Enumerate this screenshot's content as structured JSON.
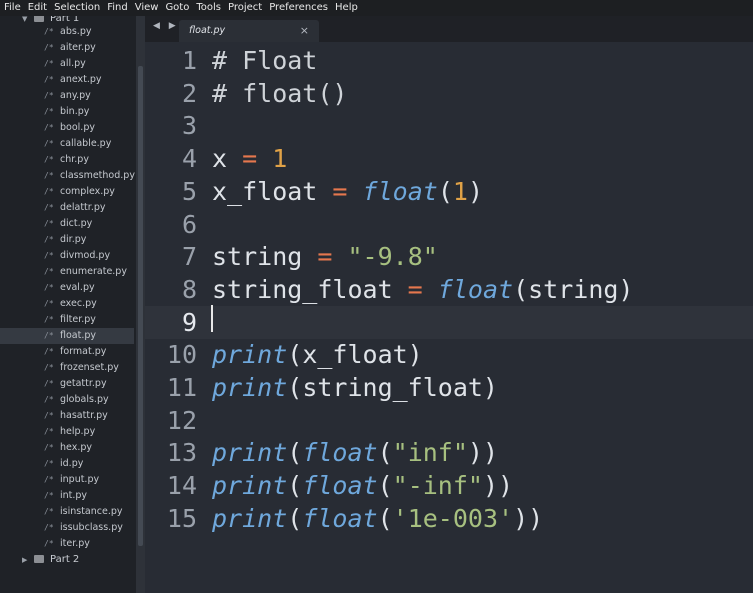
{
  "menu": [
    "File",
    "Edit",
    "Selection",
    "Find",
    "View",
    "Goto",
    "Tools",
    "Project",
    "Preferences",
    "Help"
  ],
  "sidebar": {
    "folder_top": "Part 1",
    "files": [
      "abs.py",
      "aiter.py",
      "all.py",
      "anext.py",
      "any.py",
      "bin.py",
      "bool.py",
      "callable.py",
      "chr.py",
      "classmethod.py",
      "complex.py",
      "delattr.py",
      "dict.py",
      "dir.py",
      "divmod.py",
      "enumerate.py",
      "eval.py",
      "exec.py",
      "filter.py",
      "float.py",
      "format.py",
      "frozenset.py",
      "getattr.py",
      "globals.py",
      "hasattr.py",
      "help.py",
      "hex.py",
      "id.py",
      "input.py",
      "int.py",
      "isinstance.py",
      "issubclass.py",
      "iter.py"
    ],
    "selected_file": "float.py",
    "file_glyph": "/*",
    "folder_bottom": "Part 2"
  },
  "tabs": {
    "nav_arrows": "◀ ▶",
    "active_tab": "float.py",
    "close_glyph": "×"
  },
  "editor": {
    "current_line": 9,
    "lines": [
      {
        "n": "1",
        "tokens": [
          [
            "cmt",
            "# Float"
          ]
        ]
      },
      {
        "n": "2",
        "tokens": [
          [
            "cmt",
            "# float()"
          ]
        ]
      },
      {
        "n": "3",
        "tokens": []
      },
      {
        "n": "4",
        "tokens": [
          [
            "pn",
            "x "
          ],
          [
            "op",
            "="
          ],
          [
            "pn",
            " "
          ],
          [
            "num",
            "1"
          ]
        ]
      },
      {
        "n": "5",
        "tokens": [
          [
            "pn",
            "x_float "
          ],
          [
            "op",
            "="
          ],
          [
            "pn",
            " "
          ],
          [
            "fn",
            "float"
          ],
          [
            "pn",
            "("
          ],
          [
            "num",
            "1"
          ],
          [
            "pn",
            ")"
          ]
        ]
      },
      {
        "n": "6",
        "tokens": []
      },
      {
        "n": "7",
        "tokens": [
          [
            "pn",
            "string "
          ],
          [
            "op",
            "="
          ],
          [
            "pn",
            " "
          ],
          [
            "str",
            "\"-9.8\""
          ]
        ]
      },
      {
        "n": "8",
        "tokens": [
          [
            "pn",
            "string_float "
          ],
          [
            "op",
            "="
          ],
          [
            "pn",
            " "
          ],
          [
            "fn",
            "float"
          ],
          [
            "pn",
            "(string)"
          ]
        ]
      },
      {
        "n": "9",
        "tokens": []
      },
      {
        "n": "10",
        "tokens": [
          [
            "fn",
            "print"
          ],
          [
            "pn",
            "(x_float)"
          ]
        ]
      },
      {
        "n": "11",
        "tokens": [
          [
            "fn",
            "print"
          ],
          [
            "pn",
            "(string_float)"
          ]
        ]
      },
      {
        "n": "12",
        "tokens": []
      },
      {
        "n": "13",
        "tokens": [
          [
            "fn",
            "print"
          ],
          [
            "pn",
            "("
          ],
          [
            "fn",
            "float"
          ],
          [
            "pn",
            "("
          ],
          [
            "str",
            "\"inf\""
          ],
          [
            "pn",
            "))"
          ]
        ]
      },
      {
        "n": "14",
        "tokens": [
          [
            "fn",
            "print"
          ],
          [
            "pn",
            "("
          ],
          [
            "fn",
            "float"
          ],
          [
            "pn",
            "("
          ],
          [
            "str",
            "\"-inf\""
          ],
          [
            "pn",
            "))"
          ]
        ]
      },
      {
        "n": "15",
        "tokens": [
          [
            "fn",
            "print"
          ],
          [
            "pn",
            "("
          ],
          [
            "fn",
            "float"
          ],
          [
            "pn",
            "("
          ],
          [
            "str",
            "'1e-003'"
          ],
          [
            "pn",
            "))"
          ]
        ]
      }
    ]
  },
  "colors": {
    "background": "#282c34",
    "keyword_operator": "#e6774e",
    "number": "#e0a247",
    "function": "#6fa8dc",
    "string": "#a7c080"
  }
}
